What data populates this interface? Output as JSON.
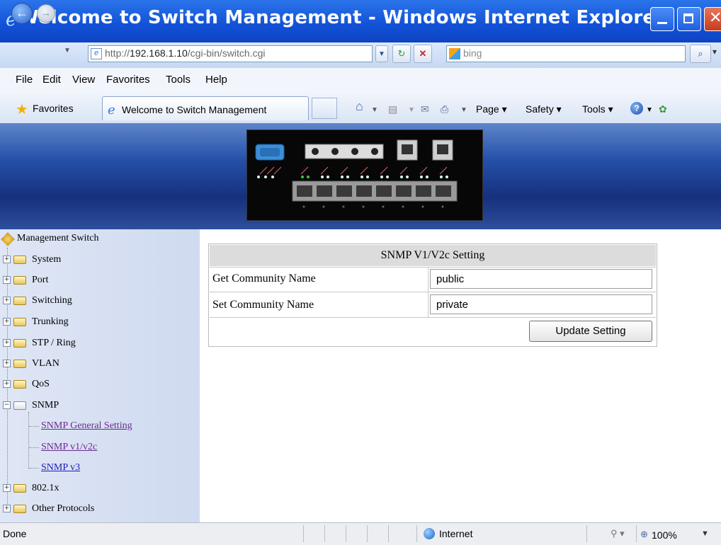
{
  "window": {
    "title": "Welcome to Switch Management - Windows Internet Explorer"
  },
  "address_bar": {
    "url_prefix": "http://",
    "url_host": "192.168.1.10",
    "url_path": "/cgi-bin/switch.cgi",
    "search_placeholder": "bing"
  },
  "menu": [
    "File",
    "Edit",
    "View",
    "Favorites",
    "Tools",
    "Help"
  ],
  "favorites_bar": {
    "favorites_label": "Favorites",
    "tab_label": "Welcome to Switch Management"
  },
  "command_bar": {
    "page": "Page ▾",
    "safety": "Safety ▾",
    "tools": "Tools ▾"
  },
  "sidebar": {
    "root": "Management Switch",
    "items": [
      {
        "label": "System"
      },
      {
        "label": "Port"
      },
      {
        "label": "Switching"
      },
      {
        "label": "Trunking"
      },
      {
        "label": "STP / Ring"
      },
      {
        "label": "VLAN"
      },
      {
        "label": "QoS"
      },
      {
        "label": "SNMP"
      },
      {
        "label": "802.1x"
      },
      {
        "label": "Other Protocols"
      }
    ],
    "snmp_children": [
      {
        "label": "SNMP General Setting"
      },
      {
        "label": "SNMP v1/v2c"
      },
      {
        "label": "SNMP v3"
      }
    ]
  },
  "form": {
    "title": "SNMP V1/V2c Setting",
    "get_label": "Get Community Name",
    "get_value": "public",
    "set_label": "Set Community Name",
    "set_value": "private",
    "button": "Update Setting"
  },
  "status_bar": {
    "status": "Done",
    "zone": "Internet",
    "zoom": "100%"
  },
  "colors": {
    "visited_link": "#6b2a8f",
    "link": "#1a1ab8",
    "titlebar": "#1251d6"
  }
}
